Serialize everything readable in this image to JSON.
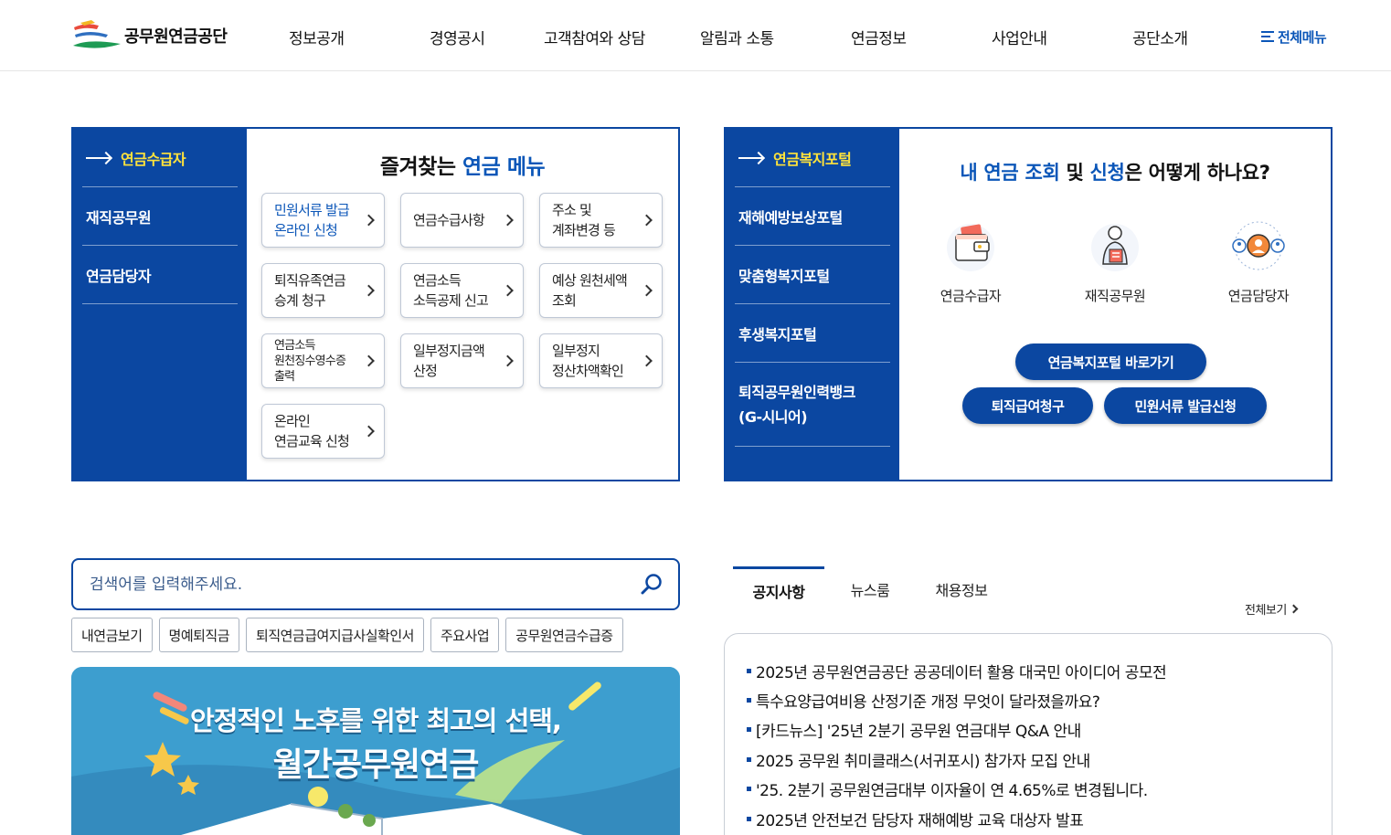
{
  "header": {
    "logo_text": "공무원연금공단",
    "nav": [
      "정보공개",
      "경영공시",
      "고객참여와 상담",
      "알림과 소통",
      "연금정보",
      "사업안내",
      "공단소개"
    ],
    "all_menu_label": "전체메뉴"
  },
  "pension_panel": {
    "side_items": [
      {
        "label": "연금수급자",
        "active": true
      },
      {
        "label": "재직공무원",
        "active": false
      },
      {
        "label": "연금담당자",
        "active": false
      }
    ],
    "title_pre": "즐겨찾는 ",
    "title_em": "연금 메뉴",
    "tiles": [
      {
        "line1": "민원서류 발급",
        "line2": "온라인 신청",
        "highlight": true
      },
      {
        "line1": "연금수급사항",
        "line2": ""
      },
      {
        "line1": "주소 및",
        "line2": "계좌변경 등"
      },
      {
        "line1": "퇴직유족연금",
        "line2": "승계 청구"
      },
      {
        "line1": "연금소득",
        "line2": "소득공제 신고"
      },
      {
        "line1": "예상 원천세액",
        "line2": "조회"
      },
      {
        "line1": "연금소득",
        "line2": "원천징수영수증",
        "line3": "출력"
      },
      {
        "line1": "일부정지금액",
        "line2": "산정"
      },
      {
        "line1": "일부정지",
        "line2": "정산차액확인"
      },
      {
        "line1": "온라인",
        "line2": "연금교육 신청"
      }
    ]
  },
  "welfare_panel": {
    "side_items": [
      {
        "label": "연금복지포털",
        "active": true
      },
      {
        "label": "재해예방보상포털"
      },
      {
        "label": "맞춤형복지포털"
      },
      {
        "label": "후생복지포털"
      },
      {
        "label": "퇴직공무원인력뱅크",
        "label2": "(G-시니어)"
      }
    ],
    "question": {
      "p1": "내 연금 조회",
      "p2": " 및 ",
      "p3": "신청",
      "p4": "은 어떻게 하나요?"
    },
    "personas": [
      {
        "label": "연금수급자",
        "icon": "wallet-icon"
      },
      {
        "label": "재직공무원",
        "icon": "office-worker-icon"
      },
      {
        "label": "연금담당자",
        "icon": "manager-icon"
      }
    ],
    "buttons": {
      "portal": "연금복지포털 바로가기",
      "retire": "퇴직급여청구",
      "docs": "민원서류 발급신청"
    }
  },
  "search": {
    "placeholder": "검색어를 입력해주세요.",
    "keywords": [
      "내연금보기",
      "명예퇴직금",
      "퇴직연금급여지급사실확인서",
      "주요사업",
      "공무원연금수급증"
    ]
  },
  "banner": {
    "line1": "안정적인 노후를 위한 최고의 선택,",
    "line2": "월간공무원연금"
  },
  "notice": {
    "tabs": [
      "공지사항",
      "뉴스룸",
      "채용정보"
    ],
    "more_label": "전체보기",
    "items": [
      "2025년 공무원연금공단 공공데이터 활용 대국민 아이디어 공모전",
      "특수요양급여비용 산정기준 개정 무엇이 달라졌을까요?",
      "[카드뉴스] '25년 2분기 공무원 연금대부 Q&A 안내",
      "2025 공무원 취미클래스(서귀포시) 참가자 모집 안내",
      "'25. 2분기 공무원연금대부 이자율이 연 4.65%로 변경됩니다.",
      "2025년 안전보건 담당자 재해예방 교육 대상자 발표"
    ]
  },
  "colors": {
    "brand": "#0b47a1",
    "accent_yellow": "#ffe33b",
    "text_blue": "#0b56b8"
  }
}
